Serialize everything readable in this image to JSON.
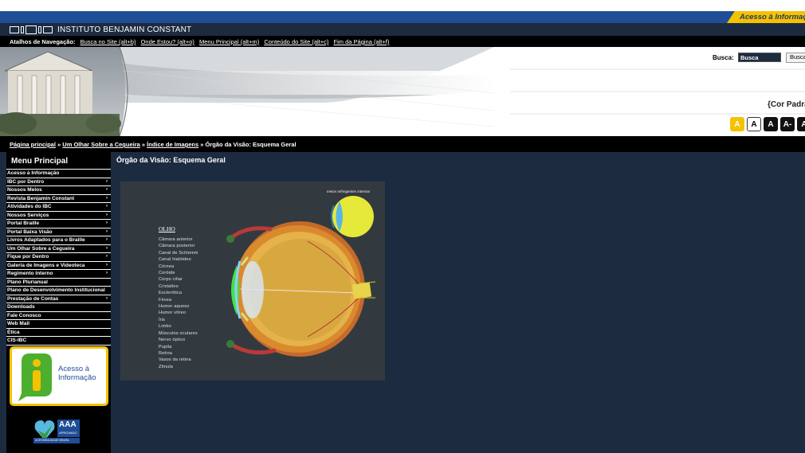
{
  "header": {
    "acesso_tab": "Acesso à Informação",
    "institution": "INSTITUTO BENJAMIN CONSTANT"
  },
  "shortcuts": {
    "title": "Atalhos de Navegação:",
    "links": [
      "Busca no Site (alt+b)",
      "Onde Estou? (alt+o)",
      "Menu Principal (alt+m)",
      "Conteúdo do Site (alt+c)",
      "Fim da Página (alt+f)"
    ]
  },
  "search": {
    "label": "Busca:",
    "value": "Busca",
    "button": "Busca"
  },
  "contrast": {
    "label": "{Cor Padrão"
  },
  "font_buttons": [
    "A",
    "A",
    "A",
    "A-",
    "A"
  ],
  "breadcrumb": {
    "items": [
      "Página principal",
      "Um Olhar Sobre a Cegueira",
      "Índice de Imagens"
    ],
    "separator": " » ",
    "current": "Órgão da Visão: Esquema Geral"
  },
  "sidebar": {
    "title": "Menu Principal",
    "items": [
      {
        "label": "Acesso à Informação",
        "arrow": ""
      },
      {
        "label": "IBC por Dentro",
        "arrow": "›"
      },
      {
        "label": "Nossos Meios",
        "arrow": "›"
      },
      {
        "label": "Revista Benjamin Constant",
        "arrow": "›"
      },
      {
        "label": "Atividades do IBC",
        "arrow": "›"
      },
      {
        "label": "Nossos Serviços",
        "arrow": "›"
      },
      {
        "label": "Portal Braille",
        "arrow": "›"
      },
      {
        "label": "Portal Baixa Visão",
        "arrow": "›"
      },
      {
        "label": "Livros Adaptados para o Braille",
        "arrow": "›"
      },
      {
        "label": "Um Olhar Sobre a Cegueira",
        "arrow": "›"
      },
      {
        "label": "Fique por Dentro",
        "arrow": "›"
      },
      {
        "label": "Galeria de Imagens e Videoteca",
        "arrow": "›"
      },
      {
        "label": "Regimento Interno",
        "arrow": "›"
      },
      {
        "label": "Plano Plurianual",
        "arrow": ""
      },
      {
        "label": "Plano de Desenvolvimento Institucional",
        "arrow": ""
      },
      {
        "label": "Prestação de Contas",
        "arrow": "›"
      },
      {
        "label": "Downloads",
        "arrow": ""
      },
      {
        "label": "Fale Conosco",
        "arrow": ""
      },
      {
        "label": "Web Mail",
        "arrow": ""
      },
      {
        "label": "Ética",
        "arrow": ""
      },
      {
        "label": "CIS-IBC",
        "arrow": ""
      }
    ],
    "acesso_banner": {
      "line1": "Acesso à",
      "line2": "Informação"
    },
    "aaa_badge": {
      "title": "AAA",
      "sub": "APROVADO",
      "footer": "ACESSIBILIDADE BRASIL"
    }
  },
  "content": {
    "title": "Órgão da Visão: Esquema Geral"
  },
  "eye_figure": {
    "main_label": "OLHO",
    "inset_label": "meios refringentes internos",
    "parts": [
      "Câmara anterior",
      "Câmara posterior",
      "Canal de Schlemm",
      "Canal hialóideo",
      "Córnea",
      "Coróide",
      "Corpo ciliar",
      "Cristalino",
      "Esclerótica",
      "Fóvea",
      "Humor aquoso",
      "Humor vítreo",
      "Íris",
      "Limbo",
      "Músculos oculares",
      "Nervo óptico",
      "Pupila",
      "Retina",
      "Vasos da retina",
      "Zônula"
    ]
  },
  "colors": {
    "gov_blue": "#1f4e97",
    "gov_yellow": "#f5c200",
    "page_bg": "#1d2b41",
    "sidebar_bg": "#000000"
  }
}
